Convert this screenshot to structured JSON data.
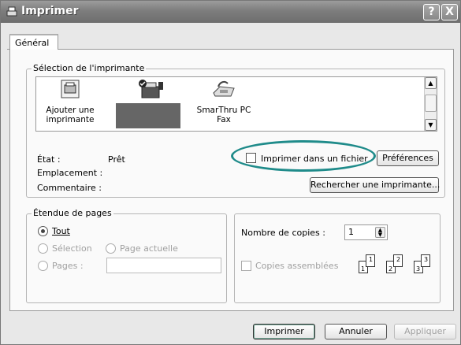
{
  "window": {
    "title": "Imprimer",
    "help_btn": "?",
    "close_btn": "X"
  },
  "tabs": [
    {
      "label": "Général"
    }
  ],
  "printer_group": {
    "legend": "Sélection de l'imprimante",
    "items": [
      {
        "label_line1": "Ajouter une",
        "label_line2": "imprimante",
        "icon": "add-printer-icon"
      },
      {
        "label_line1": "",
        "label_line2": "",
        "icon": "selected-printer-icon"
      },
      {
        "label_line1": "SmarThru PC",
        "label_line2": "Fax",
        "icon": "fax-icon"
      }
    ],
    "status_label": "État :",
    "status_value": "Prêt",
    "location_label": "Emplacement :",
    "comment_label": "Commentaire :",
    "print_to_file_label": "Imprimer dans un fichier",
    "preferences_btn": "Préférences",
    "find_printer_btn": "Rechercher une imprimante..."
  },
  "page_range": {
    "legend": "Étendue de pages",
    "all": "Tout",
    "selection": "Sélection",
    "current_page": "Page actuelle",
    "pages": "Pages :",
    "pages_value": ""
  },
  "copies": {
    "count_label": "Nombre de copies :",
    "count_value": "1",
    "collate_label": "Copies assemblées",
    "page_numbers": [
      "1",
      "1",
      "2",
      "2",
      "3",
      "3"
    ]
  },
  "footer": {
    "print_btn": "Imprimer",
    "cancel_btn": "Annuler",
    "apply_btn": "Appliquer"
  },
  "colors": {
    "highlight_oval": "#1f8b8a"
  }
}
